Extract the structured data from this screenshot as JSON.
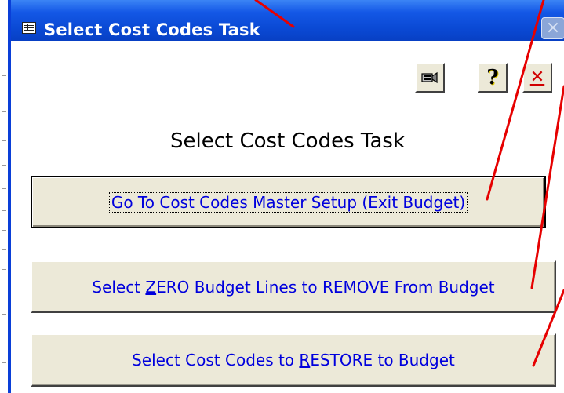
{
  "window": {
    "title": "Select Cost Codes Task"
  },
  "toolbar": {
    "icons": [
      "camera-icon",
      "help-icon",
      "close-icon"
    ],
    "help_glyph": "?",
    "close_glyph": "✕"
  },
  "form": {
    "heading": "Select Cost Codes Task",
    "buttons": [
      {
        "label": "Go To Cost Codes Master Setup (Exit Budget)"
      },
      {
        "label_pre": "Select ",
        "label_accel": "Z",
        "label_post": "ERO Budget Lines to REMOVE From Budget"
      },
      {
        "label_pre": "Select Cost Codes to ",
        "label_accel": "R",
        "label_post": "ESTORE to Budget"
      }
    ]
  },
  "colors": {
    "titlebar": "#0a49d4",
    "button_face": "#ece9d8",
    "button_text": "#0000dd",
    "annotation": "#e00000"
  }
}
